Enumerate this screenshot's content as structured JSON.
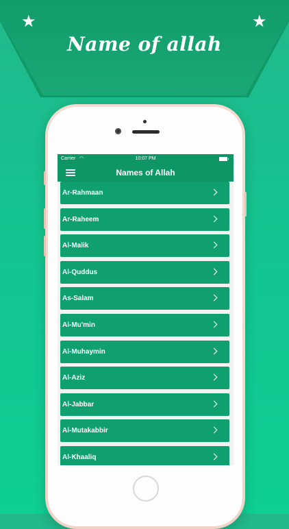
{
  "banner": {
    "title": "Name of allah"
  },
  "statusbar": {
    "carrier": "Carrier",
    "time": "10:07 PM"
  },
  "navbar": {
    "title": "Names of Allah"
  },
  "names": [
    "Ar-Rahmaan",
    "Ar-Raheem",
    "Al-Malik",
    "Al-Quddus",
    "As-Salam",
    "Al-Mu'min",
    "Al-Muhaymin",
    "Al-Aziz",
    "Al-Jabbar",
    "Al-Mutakabbir",
    "Al-Khaaliq"
  ],
  "colors": {
    "accent": "#10a070",
    "background": "#14c48f",
    "banner": "#0f9a68"
  }
}
